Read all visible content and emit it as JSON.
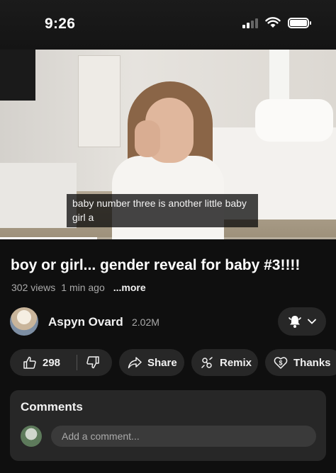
{
  "status_bar": {
    "time": "9:26"
  },
  "video": {
    "caption": "baby number three is another little baby girl a",
    "progress": 0.29
  },
  "title": "boy or girl... gender reveal for baby #3!!!!",
  "meta": {
    "views": "302 views",
    "age": "1 min ago",
    "more": "...more"
  },
  "channel": {
    "name": "Aspyn Ovard",
    "subscribers": "2.02M"
  },
  "actions": {
    "likes": "298",
    "share": "Share",
    "remix": "Remix",
    "thanks": "Thanks"
  },
  "comments": {
    "title": "Comments",
    "placeholder": "Add a comment..."
  }
}
